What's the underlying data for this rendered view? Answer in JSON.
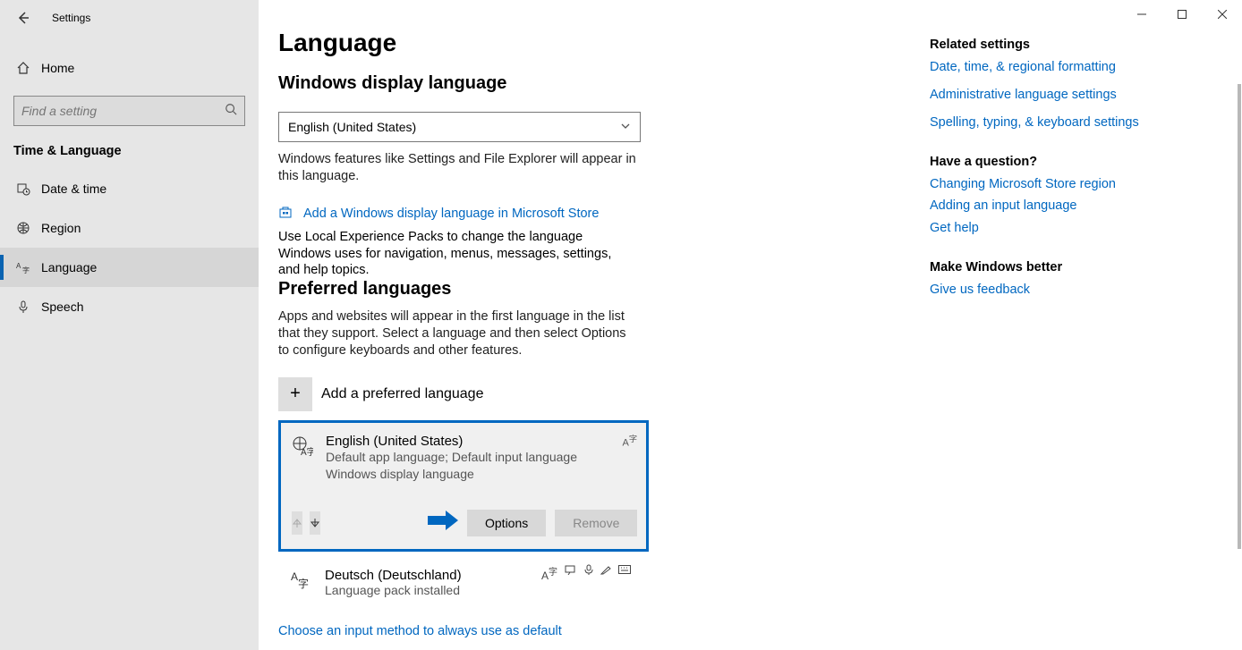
{
  "app": {
    "title": "Settings"
  },
  "sidebar": {
    "home": "Home",
    "search_placeholder": "Find a setting",
    "section": "Time & Language",
    "items": [
      {
        "label": "Date & time"
      },
      {
        "label": "Region"
      },
      {
        "label": "Language"
      },
      {
        "label": "Speech"
      }
    ]
  },
  "main": {
    "title": "Language",
    "display_heading": "Windows display language",
    "display_value": "English (United States)",
    "display_desc": "Windows features like Settings and File Explorer will appear in this language.",
    "store_link": "Add a Windows display language in Microsoft Store",
    "store_desc": "Use Local Experience Packs to change the language Windows uses for navigation, menus, messages, settings, and help topics.",
    "pref_heading": "Preferred languages",
    "pref_desc": "Apps and websites will appear in the first language in the list that they support. Select a language and then select Options to configure keyboards and other features.",
    "add_label": "Add a preferred language",
    "lang1": {
      "name": "English (United States)",
      "sub1": "Default app language; Default input language",
      "sub2": "Windows display language",
      "options": "Options",
      "remove": "Remove"
    },
    "lang2": {
      "name": "Deutsch (Deutschland)",
      "sub": "Language pack installed"
    },
    "bottom_link": "Choose an input method to always use as default"
  },
  "right": {
    "related_heading": "Related settings",
    "r1": "Date, time, & regional formatting",
    "r2": "Administrative language settings",
    "r3": "Spelling, typing, & keyboard settings",
    "question_heading": "Have a question?",
    "q1": "Changing Microsoft Store region",
    "q2": "Adding an input language",
    "q3": "Get help",
    "better_heading": "Make Windows better",
    "b1": "Give us feedback"
  }
}
